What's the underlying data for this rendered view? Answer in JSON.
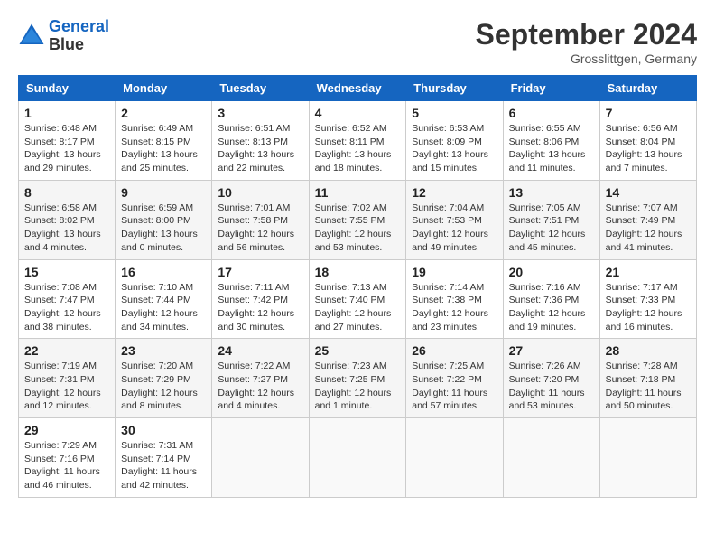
{
  "header": {
    "logo_line1": "General",
    "logo_line2": "Blue",
    "month": "September 2024",
    "location": "Grosslittgen, Germany"
  },
  "weekdays": [
    "Sunday",
    "Monday",
    "Tuesday",
    "Wednesday",
    "Thursday",
    "Friday",
    "Saturday"
  ],
  "weeks": [
    [
      {
        "day": "1",
        "info": "Sunrise: 6:48 AM\nSunset: 8:17 PM\nDaylight: 13 hours\nand 29 minutes."
      },
      {
        "day": "2",
        "info": "Sunrise: 6:49 AM\nSunset: 8:15 PM\nDaylight: 13 hours\nand 25 minutes."
      },
      {
        "day": "3",
        "info": "Sunrise: 6:51 AM\nSunset: 8:13 PM\nDaylight: 13 hours\nand 22 minutes."
      },
      {
        "day": "4",
        "info": "Sunrise: 6:52 AM\nSunset: 8:11 PM\nDaylight: 13 hours\nand 18 minutes."
      },
      {
        "day": "5",
        "info": "Sunrise: 6:53 AM\nSunset: 8:09 PM\nDaylight: 13 hours\nand 15 minutes."
      },
      {
        "day": "6",
        "info": "Sunrise: 6:55 AM\nSunset: 8:06 PM\nDaylight: 13 hours\nand 11 minutes."
      },
      {
        "day": "7",
        "info": "Sunrise: 6:56 AM\nSunset: 8:04 PM\nDaylight: 13 hours\nand 7 minutes."
      }
    ],
    [
      {
        "day": "8",
        "info": "Sunrise: 6:58 AM\nSunset: 8:02 PM\nDaylight: 13 hours\nand 4 minutes."
      },
      {
        "day": "9",
        "info": "Sunrise: 6:59 AM\nSunset: 8:00 PM\nDaylight: 13 hours\nand 0 minutes."
      },
      {
        "day": "10",
        "info": "Sunrise: 7:01 AM\nSunset: 7:58 PM\nDaylight: 12 hours\nand 56 minutes."
      },
      {
        "day": "11",
        "info": "Sunrise: 7:02 AM\nSunset: 7:55 PM\nDaylight: 12 hours\nand 53 minutes."
      },
      {
        "day": "12",
        "info": "Sunrise: 7:04 AM\nSunset: 7:53 PM\nDaylight: 12 hours\nand 49 minutes."
      },
      {
        "day": "13",
        "info": "Sunrise: 7:05 AM\nSunset: 7:51 PM\nDaylight: 12 hours\nand 45 minutes."
      },
      {
        "day": "14",
        "info": "Sunrise: 7:07 AM\nSunset: 7:49 PM\nDaylight: 12 hours\nand 41 minutes."
      }
    ],
    [
      {
        "day": "15",
        "info": "Sunrise: 7:08 AM\nSunset: 7:47 PM\nDaylight: 12 hours\nand 38 minutes."
      },
      {
        "day": "16",
        "info": "Sunrise: 7:10 AM\nSunset: 7:44 PM\nDaylight: 12 hours\nand 34 minutes."
      },
      {
        "day": "17",
        "info": "Sunrise: 7:11 AM\nSunset: 7:42 PM\nDaylight: 12 hours\nand 30 minutes."
      },
      {
        "day": "18",
        "info": "Sunrise: 7:13 AM\nSunset: 7:40 PM\nDaylight: 12 hours\nand 27 minutes."
      },
      {
        "day": "19",
        "info": "Sunrise: 7:14 AM\nSunset: 7:38 PM\nDaylight: 12 hours\nand 23 minutes."
      },
      {
        "day": "20",
        "info": "Sunrise: 7:16 AM\nSunset: 7:36 PM\nDaylight: 12 hours\nand 19 minutes."
      },
      {
        "day": "21",
        "info": "Sunrise: 7:17 AM\nSunset: 7:33 PM\nDaylight: 12 hours\nand 16 minutes."
      }
    ],
    [
      {
        "day": "22",
        "info": "Sunrise: 7:19 AM\nSunset: 7:31 PM\nDaylight: 12 hours\nand 12 minutes."
      },
      {
        "day": "23",
        "info": "Sunrise: 7:20 AM\nSunset: 7:29 PM\nDaylight: 12 hours\nand 8 minutes."
      },
      {
        "day": "24",
        "info": "Sunrise: 7:22 AM\nSunset: 7:27 PM\nDaylight: 12 hours\nand 4 minutes."
      },
      {
        "day": "25",
        "info": "Sunrise: 7:23 AM\nSunset: 7:25 PM\nDaylight: 12 hours\nand 1 minute."
      },
      {
        "day": "26",
        "info": "Sunrise: 7:25 AM\nSunset: 7:22 PM\nDaylight: 11 hours\nand 57 minutes."
      },
      {
        "day": "27",
        "info": "Sunrise: 7:26 AM\nSunset: 7:20 PM\nDaylight: 11 hours\nand 53 minutes."
      },
      {
        "day": "28",
        "info": "Sunrise: 7:28 AM\nSunset: 7:18 PM\nDaylight: 11 hours\nand 50 minutes."
      }
    ],
    [
      {
        "day": "29",
        "info": "Sunrise: 7:29 AM\nSunset: 7:16 PM\nDaylight: 11 hours\nand 46 minutes."
      },
      {
        "day": "30",
        "info": "Sunrise: 7:31 AM\nSunset: 7:14 PM\nDaylight: 11 hours\nand 42 minutes."
      },
      {
        "day": "",
        "info": ""
      },
      {
        "day": "",
        "info": ""
      },
      {
        "day": "",
        "info": ""
      },
      {
        "day": "",
        "info": ""
      },
      {
        "day": "",
        "info": ""
      }
    ]
  ]
}
